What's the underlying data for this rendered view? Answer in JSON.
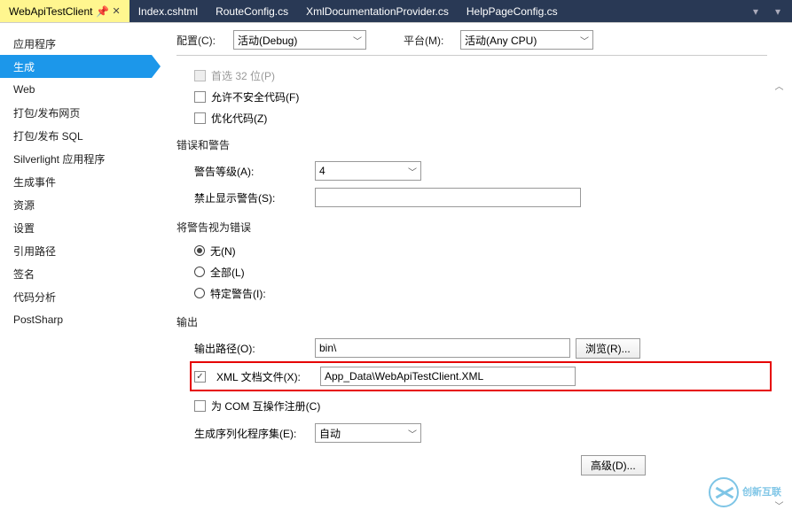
{
  "tabs": {
    "active": "WebApiTestClient",
    "others": [
      "Index.cshtml",
      "RouteConfig.cs",
      "XmlDocumentationProvider.cs",
      "HelpPageConfig.cs"
    ]
  },
  "sidebar": {
    "items": [
      "应用程序",
      "生成",
      "Web",
      "打包/发布网页",
      "打包/发布 SQL",
      "Silverlight 应用程序",
      "生成事件",
      "资源",
      "设置",
      "引用路径",
      "签名",
      "代码分析",
      "PostSharp"
    ],
    "selected": "生成"
  },
  "top": {
    "config_label": "配置(C):",
    "config_value": "活动(Debug)",
    "platform_label": "平台(M):",
    "platform_value": "活动(Any CPU)"
  },
  "general": {
    "prefer32_label": "首选 32 位(P)",
    "allow_unsafe_label": "允许不安全代码(F)",
    "optimize_label": "优化代码(Z)"
  },
  "errwarn": {
    "title": "错误和警告",
    "warn_level_label": "警告等级(A):",
    "warn_level_value": "4",
    "suppress_label": "禁止显示警告(S):",
    "suppress_value": ""
  },
  "treat": {
    "title": "将警告视为错误",
    "none": "无(N)",
    "all": "全部(L)",
    "specific": "特定警告(I):"
  },
  "output": {
    "title": "输出",
    "outpath_label": "输出路径(O):",
    "outpath_value": "bin\\",
    "browse_btn": "浏览(R)...",
    "xmldoc_label": "XML 文档文件(X):",
    "xmldoc_value": "App_Data\\WebApiTestClient.XML",
    "com_register_label": "为 COM 互操作注册(C)",
    "serialization_label": "生成序列化程序集(E):",
    "serialization_value": "自动",
    "advanced_btn": "高级(D)..."
  },
  "watermark": {
    "brand": "创新互联"
  }
}
